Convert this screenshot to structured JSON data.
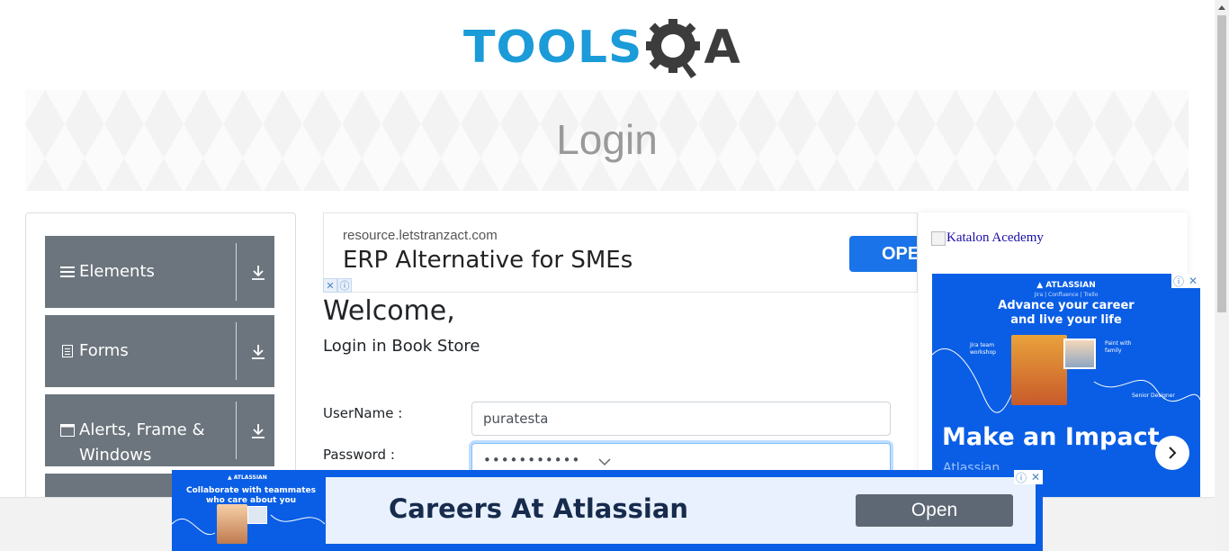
{
  "header": {
    "logo_tools": "TOOLS",
    "logo_a": "A"
  },
  "banner": {
    "title": "Login"
  },
  "sidebar": {
    "groups": [
      {
        "label_line1": "Elements",
        "label_line2": "",
        "icon": "list-icon"
      },
      {
        "label_line1": "Forms",
        "label_line2": "",
        "icon": "form-icon"
      },
      {
        "label_line1": "Alerts, Frame &",
        "label_line2": "Windows",
        "icon": "window-icon"
      }
    ]
  },
  "top_ad": {
    "url": "resource.letstranzact.com",
    "title": "ERP Alternative for SMEs",
    "button": "OPE"
  },
  "login": {
    "welcome": "Welcome,",
    "subtitle": "Login in Book Store",
    "username_label": "UserName :",
    "username_value": "puratesta",
    "password_label": "Password :",
    "password_value": "•••••••••••"
  },
  "side_ad": {
    "katalon_alt": "Katalon Acedemy",
    "brand": "ATLASSIAN",
    "sub": "Jira | Confluence | Trello",
    "headline": "Advance your career and live your life",
    "tag_jira": "Jira team workshop",
    "tag_paint": "Paint with family",
    "tag_role": "Senior Designer",
    "impact": "Make an Impact",
    "more": "Atlassian"
  },
  "bottom_ad": {
    "brand": "ATLASSIAN",
    "small_head": "Collaborate with teammates who care about you",
    "title": "Careers At Atlassian",
    "button": "Open"
  },
  "colors": {
    "brand_blue": "#1b9bd8",
    "sidebar_gray": "#6c757d",
    "atlassian_blue": "#0a5ee5"
  }
}
